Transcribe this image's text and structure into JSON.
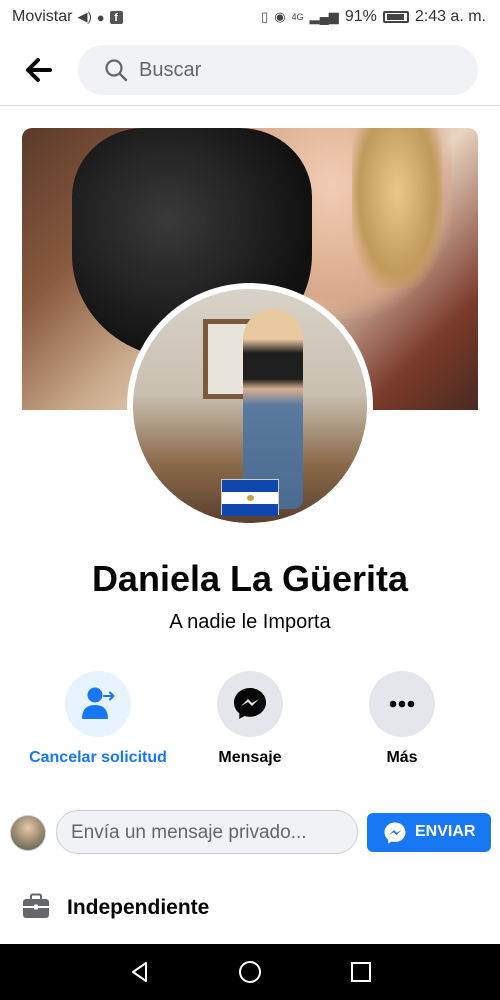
{
  "status_bar": {
    "carrier": "Movistar",
    "network": "4G",
    "battery": "91%",
    "time": "2:43 a. m."
  },
  "header": {
    "search_placeholder": "Buscar"
  },
  "profile": {
    "name": "Daniela La Güerita",
    "bio": "A nadie le Importa"
  },
  "actions": [
    {
      "label": "Cancelar solicitud",
      "icon": "person-cancel-icon"
    },
    {
      "label": "Mensaje",
      "icon": "messenger-icon"
    },
    {
      "label": "Más",
      "icon": "more-dots-icon"
    }
  ],
  "message_bar": {
    "placeholder": "Envía un mensaje privado...",
    "send_label": "ENVIAR"
  },
  "about": {
    "work": "Independiente"
  },
  "colors": {
    "accent": "#1877f2",
    "button_gray": "#e4e6eb",
    "cancel_bg": "#e7f3ff"
  }
}
